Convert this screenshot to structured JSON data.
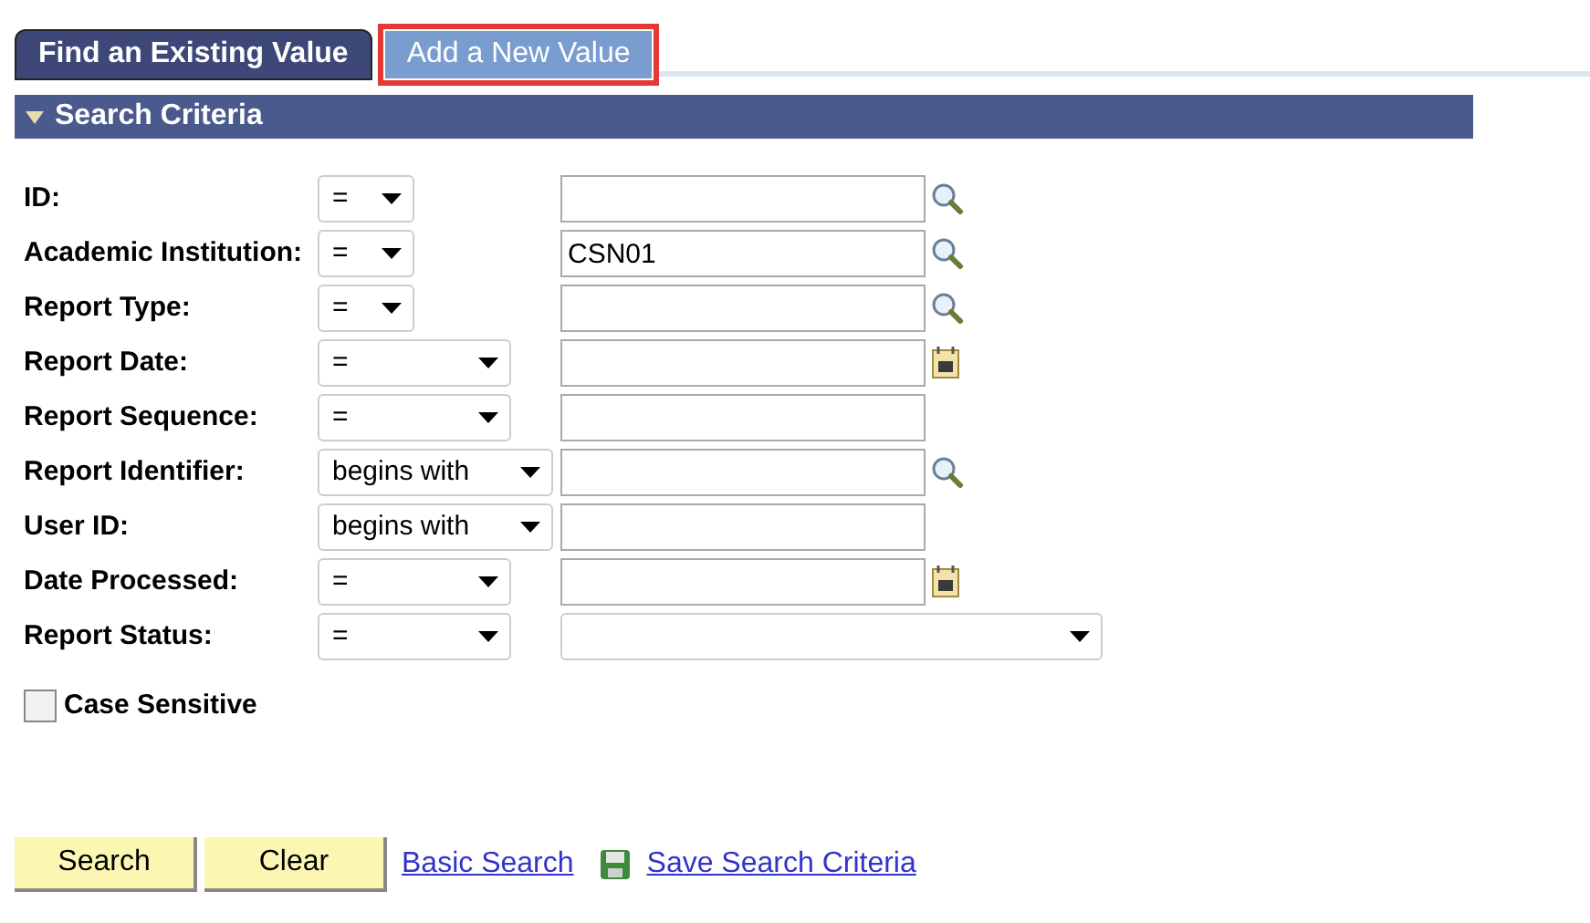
{
  "tabs": [
    {
      "label": "Find an Existing Value",
      "selected": true,
      "highlighted": false
    },
    {
      "label": "Add a New Value",
      "selected": false,
      "highlighted": true
    }
  ],
  "section": {
    "title": "Search Criteria",
    "expanded": true
  },
  "criteria": [
    {
      "label": "ID:",
      "operator": {
        "value": "=",
        "kind": "short"
      },
      "field": {
        "kind": "lookup"
      }
    },
    {
      "label": "Academic Institution:",
      "operator": {
        "value": "=",
        "kind": "short"
      },
      "field": {
        "kind": "lookup",
        "value": "CSN01"
      }
    },
    {
      "label": "Report Type:",
      "operator": {
        "value": "=",
        "kind": "short"
      },
      "field": {
        "kind": "lookup"
      }
    },
    {
      "label": "Report Date:",
      "operator": {
        "value": "=",
        "kind": "medium"
      },
      "field": {
        "kind": "date"
      }
    },
    {
      "label": "Report Sequence:",
      "operator": {
        "value": "=",
        "kind": "medium"
      },
      "field": {
        "kind": "text"
      }
    },
    {
      "label": "Report Identifier:",
      "operator": {
        "value": "begins with",
        "kind": "long"
      },
      "field": {
        "kind": "lookup"
      }
    },
    {
      "label": "User ID:",
      "operator": {
        "value": "begins with",
        "kind": "long"
      },
      "field": {
        "kind": "text"
      }
    },
    {
      "label": "Date Processed:",
      "operator": {
        "value": "=",
        "kind": "medium"
      },
      "field": {
        "kind": "date"
      }
    },
    {
      "label": "Report Status:",
      "operator": {
        "value": "=",
        "kind": "medium"
      },
      "field": {
        "kind": "dropdown"
      }
    }
  ],
  "case_sensitive": {
    "label": "Case Sensitive",
    "checked": false
  },
  "buttons": [
    "Search",
    "Clear"
  ],
  "links": [
    {
      "label": "Basic Search",
      "kind": "plain"
    },
    {
      "label": "Save Search Criteria",
      "kind": "save"
    }
  ]
}
